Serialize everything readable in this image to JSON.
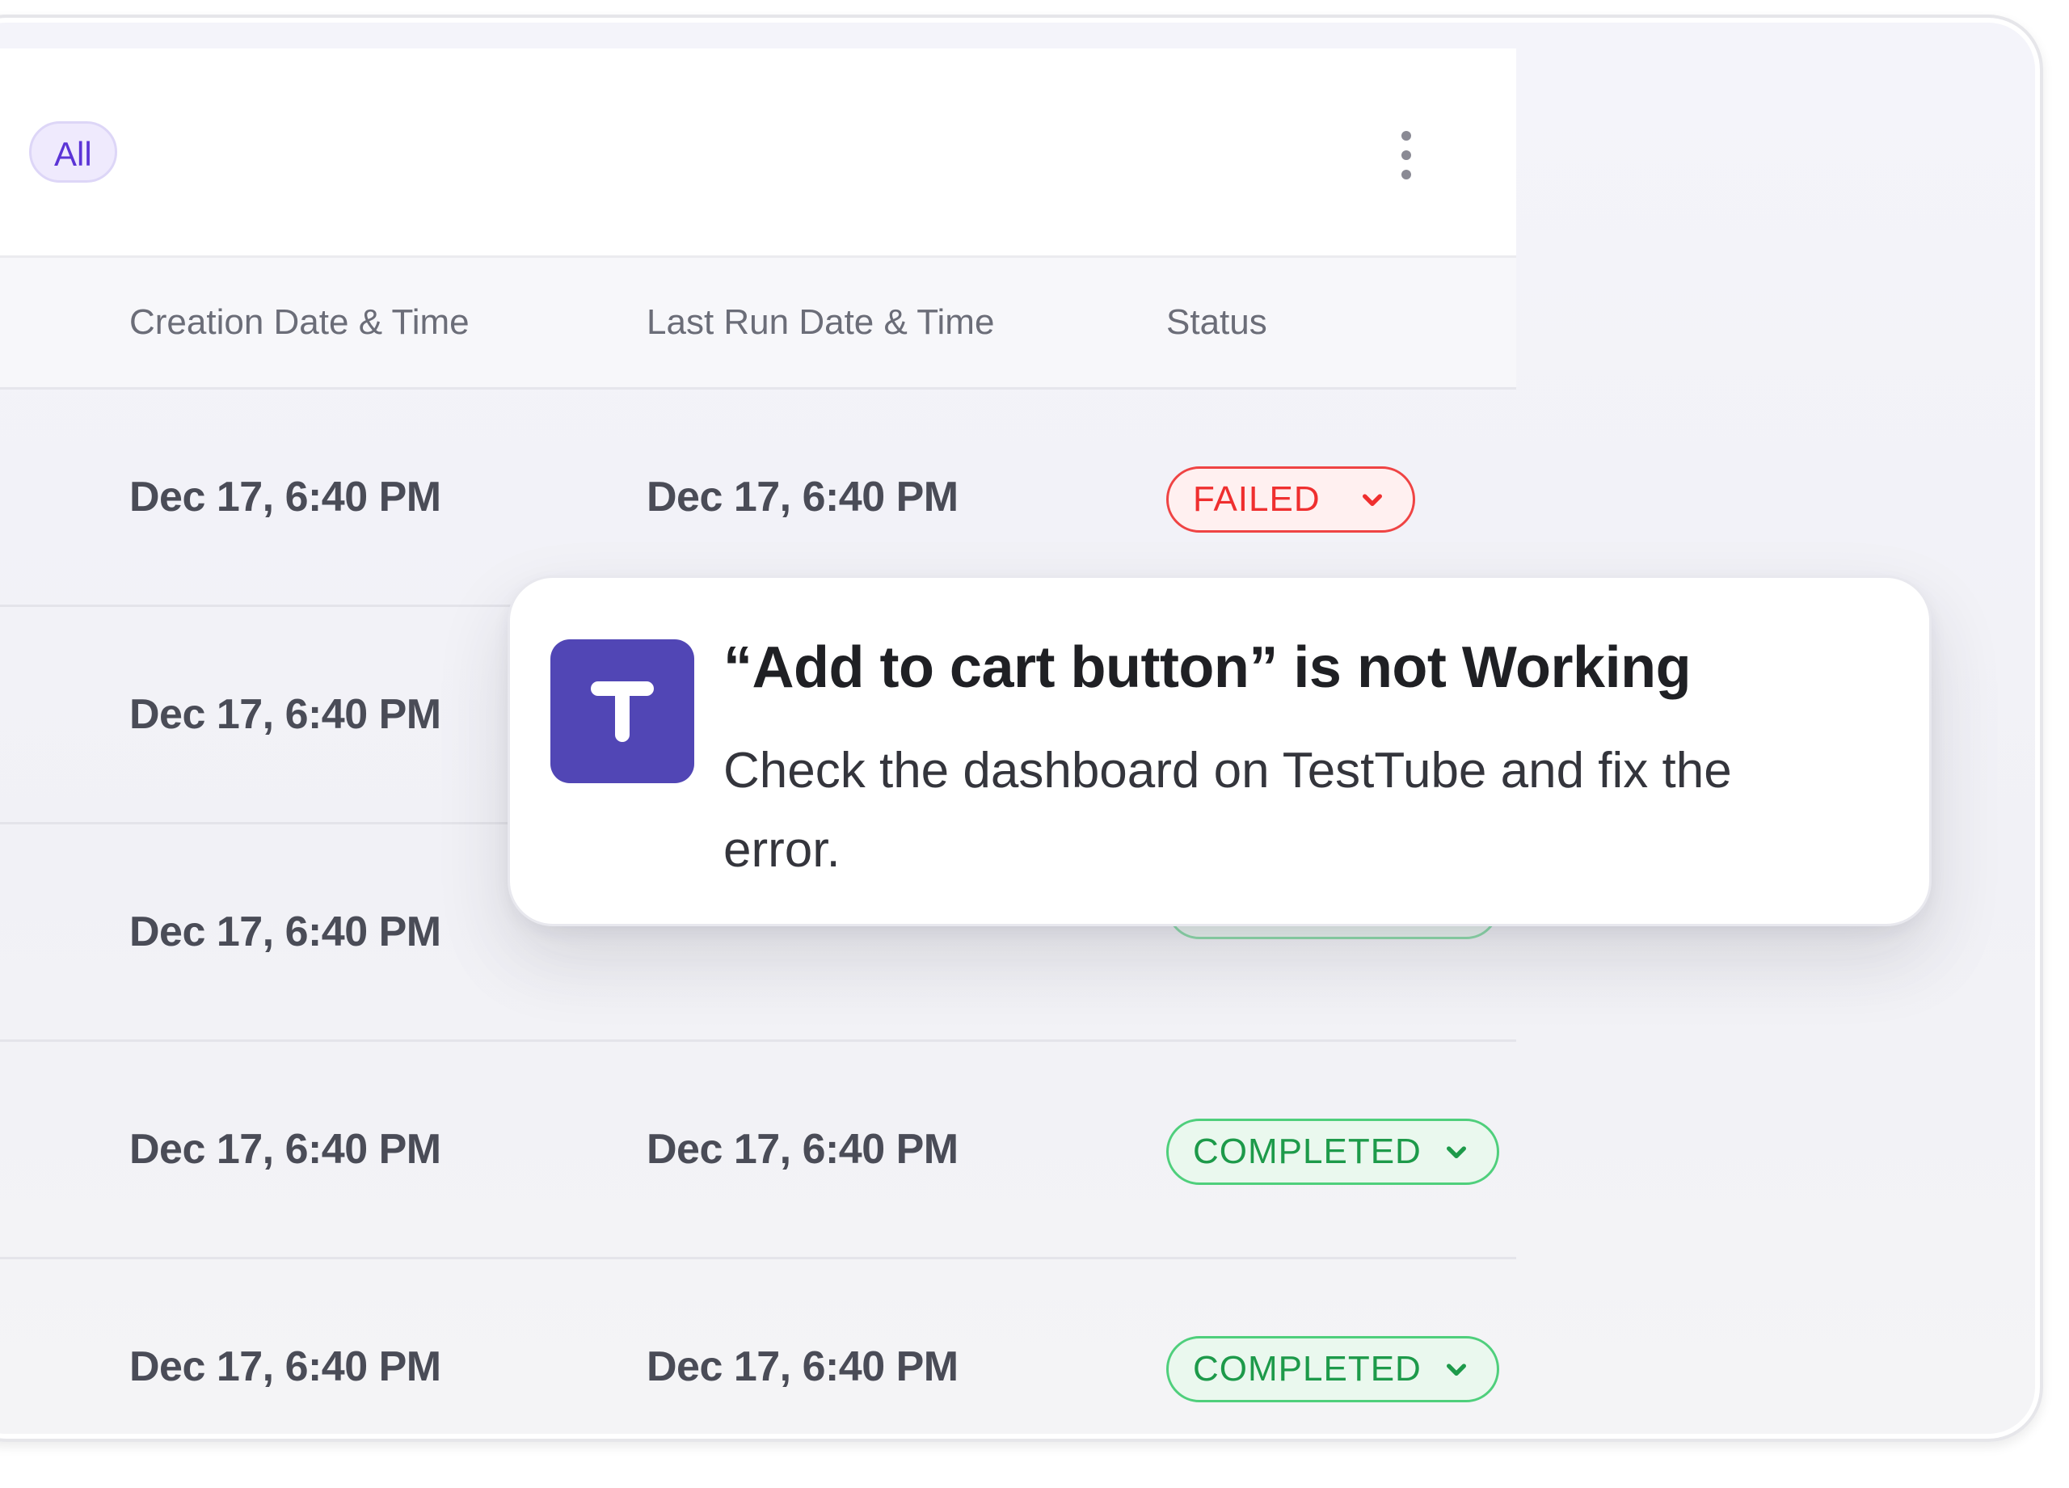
{
  "filters": {
    "all_chip": "All"
  },
  "table": {
    "columns": [
      "Creation Date & Time",
      "Last Run Date & Time",
      "Status"
    ],
    "rows": [
      {
        "created": "Dec 17, 6:40 PM",
        "last_run": "Dec 17, 6:40 PM",
        "status": "FAILED"
      },
      {
        "created": "Dec 17, 6:40 PM",
        "last_run": "",
        "status": ""
      },
      {
        "created": "Dec 17, 6:40 PM",
        "last_run": "",
        "status": ""
      },
      {
        "created": "Dec 17, 6:40 PM",
        "last_run": "Dec 17, 6:40 PM",
        "status": "COMPLETED"
      },
      {
        "created": "Dec 17, 6:40 PM",
        "last_run": "Dec 17, 6:40 PM",
        "status": "COMPLETED"
      }
    ]
  },
  "notification": {
    "logo_letter": "T",
    "title": "“Add to cart button” is not Working",
    "body": "Check the dashboard on TestTube and fix the error."
  },
  "colors": {
    "accent": "#5b34d6",
    "logo_bg": "#5146b5",
    "failed": "#ef2f2f",
    "completed": "#1d9a4a"
  },
  "icons": {
    "menu": "kebab-menu-icon",
    "status_dropdown": "chevron-down-icon"
  }
}
